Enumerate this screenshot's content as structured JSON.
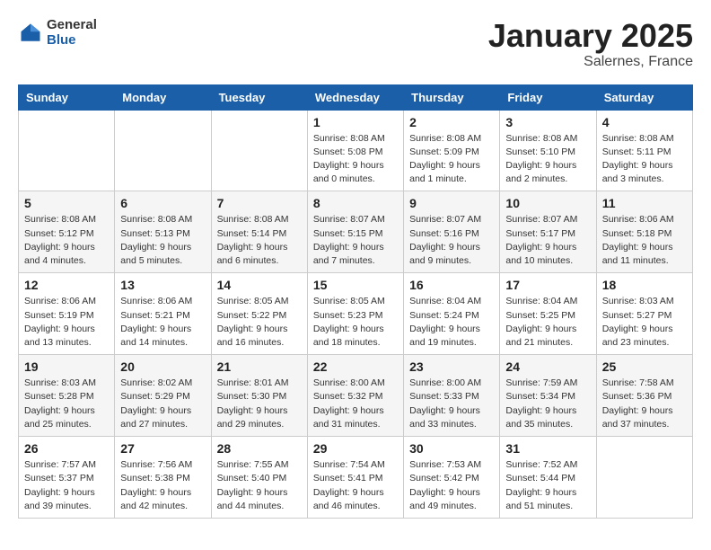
{
  "header": {
    "logo": {
      "general": "General",
      "blue": "Blue"
    },
    "title": "January 2025",
    "subtitle": "Salernes, France"
  },
  "weekdays": [
    "Sunday",
    "Monday",
    "Tuesday",
    "Wednesday",
    "Thursday",
    "Friday",
    "Saturday"
  ],
  "weeks": [
    [
      {
        "num": "",
        "info": ""
      },
      {
        "num": "",
        "info": ""
      },
      {
        "num": "",
        "info": ""
      },
      {
        "num": "1",
        "info": "Sunrise: 8:08 AM\nSunset: 5:08 PM\nDaylight: 9 hours\nand 0 minutes."
      },
      {
        "num": "2",
        "info": "Sunrise: 8:08 AM\nSunset: 5:09 PM\nDaylight: 9 hours\nand 1 minute."
      },
      {
        "num": "3",
        "info": "Sunrise: 8:08 AM\nSunset: 5:10 PM\nDaylight: 9 hours\nand 2 minutes."
      },
      {
        "num": "4",
        "info": "Sunrise: 8:08 AM\nSunset: 5:11 PM\nDaylight: 9 hours\nand 3 minutes."
      }
    ],
    [
      {
        "num": "5",
        "info": "Sunrise: 8:08 AM\nSunset: 5:12 PM\nDaylight: 9 hours\nand 4 minutes."
      },
      {
        "num": "6",
        "info": "Sunrise: 8:08 AM\nSunset: 5:13 PM\nDaylight: 9 hours\nand 5 minutes."
      },
      {
        "num": "7",
        "info": "Sunrise: 8:08 AM\nSunset: 5:14 PM\nDaylight: 9 hours\nand 6 minutes."
      },
      {
        "num": "8",
        "info": "Sunrise: 8:07 AM\nSunset: 5:15 PM\nDaylight: 9 hours\nand 7 minutes."
      },
      {
        "num": "9",
        "info": "Sunrise: 8:07 AM\nSunset: 5:16 PM\nDaylight: 9 hours\nand 9 minutes."
      },
      {
        "num": "10",
        "info": "Sunrise: 8:07 AM\nSunset: 5:17 PM\nDaylight: 9 hours\nand 10 minutes."
      },
      {
        "num": "11",
        "info": "Sunrise: 8:06 AM\nSunset: 5:18 PM\nDaylight: 9 hours\nand 11 minutes."
      }
    ],
    [
      {
        "num": "12",
        "info": "Sunrise: 8:06 AM\nSunset: 5:19 PM\nDaylight: 9 hours\nand 13 minutes."
      },
      {
        "num": "13",
        "info": "Sunrise: 8:06 AM\nSunset: 5:21 PM\nDaylight: 9 hours\nand 14 minutes."
      },
      {
        "num": "14",
        "info": "Sunrise: 8:05 AM\nSunset: 5:22 PM\nDaylight: 9 hours\nand 16 minutes."
      },
      {
        "num": "15",
        "info": "Sunrise: 8:05 AM\nSunset: 5:23 PM\nDaylight: 9 hours\nand 18 minutes."
      },
      {
        "num": "16",
        "info": "Sunrise: 8:04 AM\nSunset: 5:24 PM\nDaylight: 9 hours\nand 19 minutes."
      },
      {
        "num": "17",
        "info": "Sunrise: 8:04 AM\nSunset: 5:25 PM\nDaylight: 9 hours\nand 21 minutes."
      },
      {
        "num": "18",
        "info": "Sunrise: 8:03 AM\nSunset: 5:27 PM\nDaylight: 9 hours\nand 23 minutes."
      }
    ],
    [
      {
        "num": "19",
        "info": "Sunrise: 8:03 AM\nSunset: 5:28 PM\nDaylight: 9 hours\nand 25 minutes."
      },
      {
        "num": "20",
        "info": "Sunrise: 8:02 AM\nSunset: 5:29 PM\nDaylight: 9 hours\nand 27 minutes."
      },
      {
        "num": "21",
        "info": "Sunrise: 8:01 AM\nSunset: 5:30 PM\nDaylight: 9 hours\nand 29 minutes."
      },
      {
        "num": "22",
        "info": "Sunrise: 8:00 AM\nSunset: 5:32 PM\nDaylight: 9 hours\nand 31 minutes."
      },
      {
        "num": "23",
        "info": "Sunrise: 8:00 AM\nSunset: 5:33 PM\nDaylight: 9 hours\nand 33 minutes."
      },
      {
        "num": "24",
        "info": "Sunrise: 7:59 AM\nSunset: 5:34 PM\nDaylight: 9 hours\nand 35 minutes."
      },
      {
        "num": "25",
        "info": "Sunrise: 7:58 AM\nSunset: 5:36 PM\nDaylight: 9 hours\nand 37 minutes."
      }
    ],
    [
      {
        "num": "26",
        "info": "Sunrise: 7:57 AM\nSunset: 5:37 PM\nDaylight: 9 hours\nand 39 minutes."
      },
      {
        "num": "27",
        "info": "Sunrise: 7:56 AM\nSunset: 5:38 PM\nDaylight: 9 hours\nand 42 minutes."
      },
      {
        "num": "28",
        "info": "Sunrise: 7:55 AM\nSunset: 5:40 PM\nDaylight: 9 hours\nand 44 minutes."
      },
      {
        "num": "29",
        "info": "Sunrise: 7:54 AM\nSunset: 5:41 PM\nDaylight: 9 hours\nand 46 minutes."
      },
      {
        "num": "30",
        "info": "Sunrise: 7:53 AM\nSunset: 5:42 PM\nDaylight: 9 hours\nand 49 minutes."
      },
      {
        "num": "31",
        "info": "Sunrise: 7:52 AM\nSunset: 5:44 PM\nDaylight: 9 hours\nand 51 minutes."
      },
      {
        "num": "",
        "info": ""
      }
    ]
  ]
}
